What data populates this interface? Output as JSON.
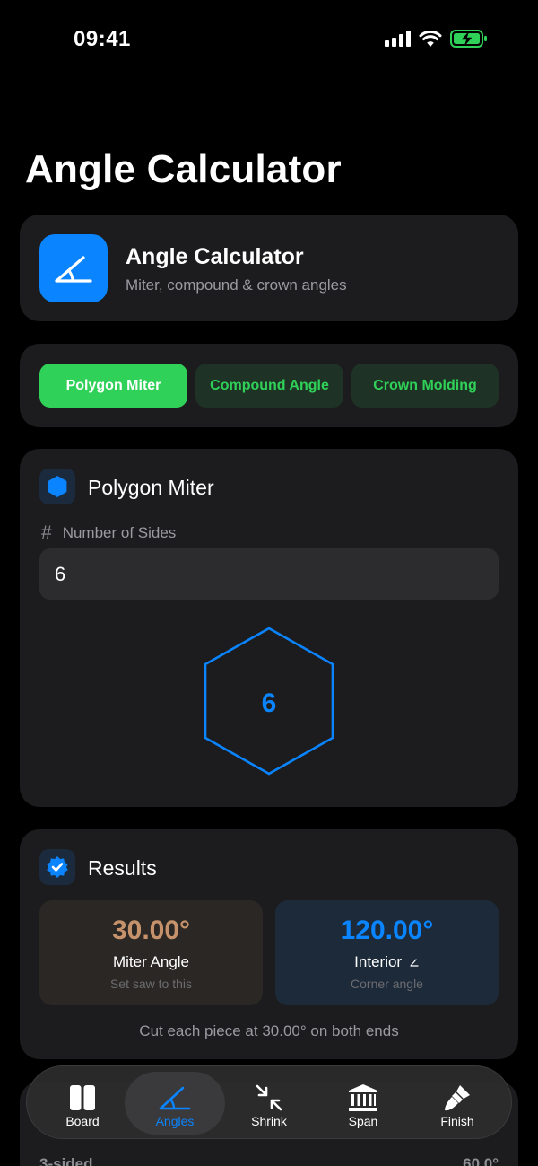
{
  "status": {
    "time": "09:41"
  },
  "page": {
    "title": "Angle Calculator"
  },
  "header": {
    "title": "Angle Calculator",
    "subtitle": "Miter, compound & crown angles",
    "icon": "angle-icon",
    "accent": "#0a84ff"
  },
  "modes": {
    "items": [
      {
        "label": "Polygon Miter",
        "active": true
      },
      {
        "label": "Compound Angle",
        "active": false
      },
      {
        "label": "Crown Molding",
        "active": false
      }
    ],
    "active_color": "#30d158"
  },
  "polygon": {
    "title": "Polygon Miter",
    "field_label": "Number of Sides",
    "sides_value": "6",
    "diagram_label": "6"
  },
  "results": {
    "title": "Results",
    "miter": {
      "value": "30.00°",
      "label": "Miter Angle",
      "hint": "Set saw to this",
      "color": "#c6926b"
    },
    "interior": {
      "value": "120.00°",
      "label": "Interior",
      "hint": "Corner angle",
      "color": "#0a84ff"
    },
    "note": "Cut each piece at 30.00° on both ends"
  },
  "reference": {
    "row_label": "3-sided",
    "row_value": "60.0°"
  },
  "tabs": [
    {
      "label": "Board",
      "icon": "board-icon",
      "active": false
    },
    {
      "label": "Angles",
      "icon": "angle-icon",
      "active": true
    },
    {
      "label": "Shrink",
      "icon": "shrink-icon",
      "active": false
    },
    {
      "label": "Span",
      "icon": "bank-icon",
      "active": false
    },
    {
      "label": "Finish",
      "icon": "paintbrush-icon",
      "active": false
    }
  ]
}
